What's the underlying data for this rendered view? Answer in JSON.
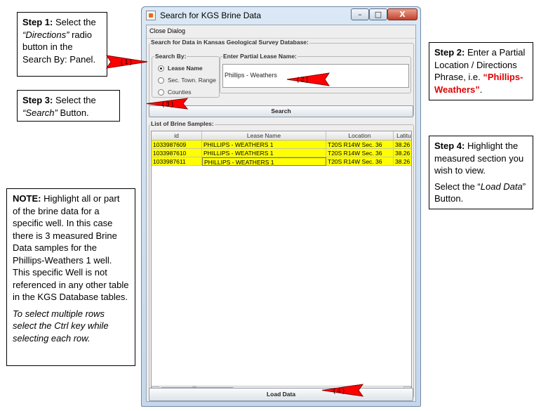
{
  "window": {
    "title": "Search for KGS Brine Data",
    "minimize": "–",
    "maximize": "□",
    "close": "X",
    "menu_close": "Close Dialog",
    "search_group_label": "Search for Data in Kansas Geological Survey Database:",
    "search_by_label": "Search By:",
    "radio_options": [
      "Lease Name",
      "Sec. Town. Range",
      "Counties"
    ],
    "selected_option": "Lease Name",
    "lease_group_label": "Enter Partial Lease Name:",
    "lease_value": "Phillips - Weathers",
    "search_button": "Search",
    "samples_label": "List of Brine Samples:",
    "columns": [
      "id",
      "Lease Name",
      "Location",
      "Latitu"
    ],
    "rows": [
      [
        "1033987609",
        "PHILLIPS - WEATHERS 1",
        "T20S R14W Sec. 36",
        "38.26"
      ],
      [
        "1033987610",
        "PHILLIPS - WEATHERS 1",
        "T20S R14W Sec. 36",
        "38.26"
      ],
      [
        "1033987611",
        "PHILLIPS - WEATHERS 1",
        "T20S R14W Sec. 36",
        "38.26"
      ]
    ],
    "load_button": "Load Data",
    "scroll_left": "◄",
    "scroll_right": "►"
  },
  "callouts": {
    "step1": {
      "head": "Step 1:",
      "t1": " Select the ",
      "em": "“Directions”",
      "t2": " radio button in the Search By: Panel."
    },
    "step2": {
      "head": "Step 2:",
      "t1": " Enter a Partial Location / Directions Phrase, i.e. ",
      "red": "“Phillips-Weathers”",
      "t2": "."
    },
    "step3": {
      "head": "Step 3:",
      "t1": " Select the ",
      "em": "“Search”",
      "t2": " Button."
    },
    "step4": {
      "head": "Step 4:",
      "t1": " Highlight the measured section you wish to view.",
      "p2a": "Select the “",
      "em": "Load Data",
      "p2b": "” Button."
    },
    "note": {
      "head": "NOTE:",
      "t1": " Highlight all or part of the brine data for a specific well.  In this case there is 3 measured Brine Data samples for the Phillips-Weathers 1 well. This specific Well is not referenced in any other table in the KGS Database tables.",
      "em": "To select multiple rows select the Ctrl key while selecting each row."
    }
  },
  "arrows": [
    "( 1 )",
    "( 2 )",
    "( 3 )",
    "( 4 )"
  ],
  "colors": {
    "arrow": "#ff0000",
    "highlight_row": "#ffff00",
    "emphasis_text": "#e00000"
  }
}
